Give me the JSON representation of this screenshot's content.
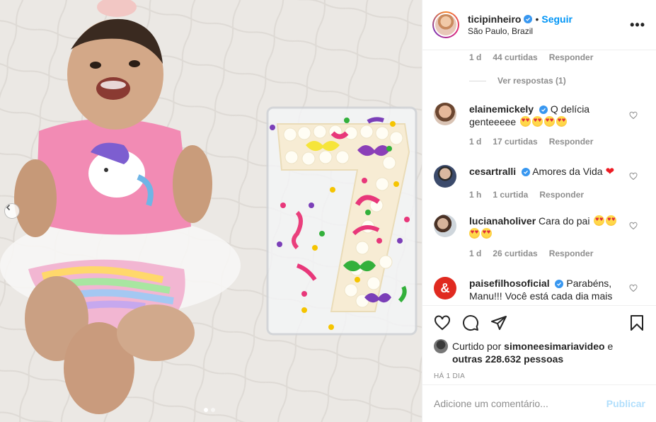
{
  "post": {
    "carousel": {
      "slides": 2,
      "active_slide": 1
    }
  },
  "header": {
    "username": "ticipinheiro",
    "separator": "•",
    "follow_label": "Seguir",
    "location": "São Paulo, Brazil",
    "more_icon": "more-horizontal-icon"
  },
  "comments": {
    "previous_meta": {
      "time": "1 d",
      "likes": "44 curtidas",
      "reply": "Responder"
    },
    "view_replies": "Ver respostas (1)",
    "items": [
      {
        "username": "elainemickely",
        "verified": true,
        "text": "Q delícia genteeeee",
        "emoji_count": 4,
        "time": "1 d",
        "likes": "17 curtidas",
        "reply": "Responder"
      },
      {
        "username": "cesartralli",
        "verified": true,
        "text": "Amores da Vida",
        "emoji": "❤",
        "time": "1 h",
        "likes": "1 curtida",
        "reply": "Responder"
      },
      {
        "username": "lucianaholiver",
        "verified": false,
        "text": "Cara do pai",
        "emoji_count": 4,
        "time": "1 d",
        "likes": "26 curtidas",
        "reply": "Responder"
      },
      {
        "username": "paisefilhosoficial",
        "verified": true,
        "text": "Parabéns, Manu!!! Você está cada dia mais"
      }
    ]
  },
  "actions": {
    "icons": [
      "heart-icon",
      "comment-icon",
      "share-icon",
      "bookmark-icon"
    ],
    "liked_by_prefix": "Curtido por",
    "liked_by_user": "simoneesimariavideo",
    "and": "e",
    "others": "outras 228.632 pessoas",
    "time_ago": "HÁ 1 DIA"
  },
  "add_comment": {
    "placeholder": "Adicione um comentário...",
    "publish_label": "Publicar"
  },
  "colors": {
    "link_blue": "#0095f6",
    "verified_blue": "#3897f0",
    "publish_disabled": "#b2dffc",
    "muted_text": "#8e8e8e"
  }
}
